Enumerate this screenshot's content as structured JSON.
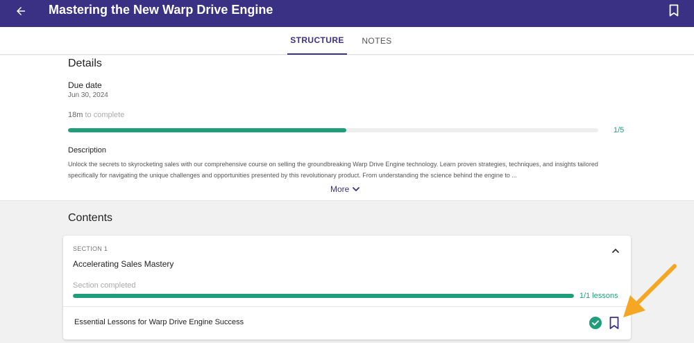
{
  "header": {
    "title": "Mastering the New Warp Drive Engine",
    "back_icon": "arrow-left-icon",
    "bookmark_icon": "bookmark-outline-icon",
    "background_color": "#3a3185"
  },
  "tabs": [
    {
      "label": "STRUCTURE",
      "active": true
    },
    {
      "label": "NOTES",
      "active": false
    }
  ],
  "details": {
    "heading": "Details",
    "due_label": "Due date",
    "due_value": "Jun 30, 2024",
    "time_value": "18m",
    "time_suffix": "to complete",
    "progress_fraction": 0.525,
    "progress_count": "1/5",
    "description_label": "Description",
    "description_text": "Unlock the secrets to skyrocketing sales with our comprehensive course on selling the groundbreaking Warp Drive Engine technology. Learn proven strategies, techniques, and insights tailored specifically for navigating the unique challenges and opportunities presented by this revolutionary product. From understanding the science behind the engine to ...",
    "more_label": "More"
  },
  "contents": {
    "heading": "Contents",
    "sections": [
      {
        "label": "SECTION 1",
        "title": "Accelerating Sales Mastery",
        "status": "Section completed",
        "progress_fraction": 1.0,
        "progress_count": "1/1 lessons",
        "lessons": [
          {
            "title": "Essential Lessons for Warp Drive Engine Success",
            "completed": true
          }
        ]
      }
    ]
  },
  "colors": {
    "accent": "#3a3185",
    "success": "#1f9e7c",
    "annotation": "#f5a623"
  }
}
